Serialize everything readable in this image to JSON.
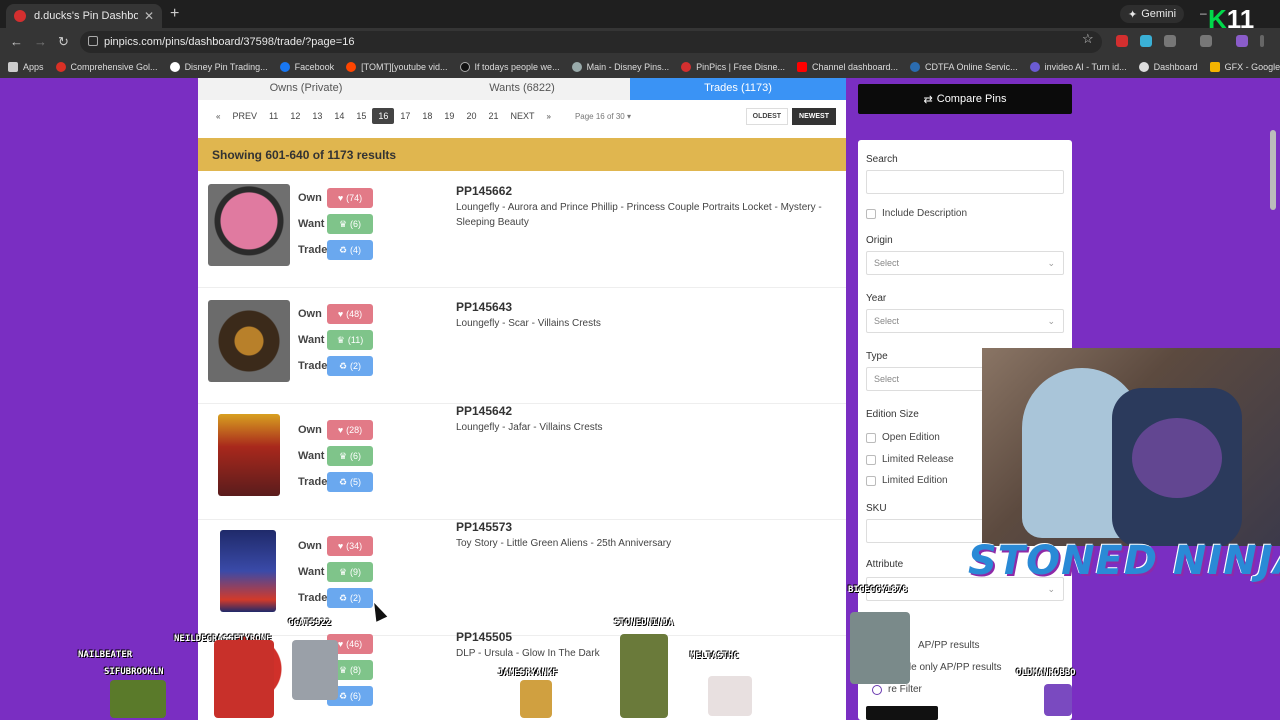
{
  "browser": {
    "tab_title": "d.ducks's Pin Dashboard - PinP",
    "url": "pinpics.com/pins/dashboard/37598/trade/?page=16",
    "gemini_label": "Gemini",
    "bookmarks": [
      {
        "label": "Apps"
      },
      {
        "label": "Comprehensive Gol..."
      },
      {
        "label": "Disney Pin Trading..."
      },
      {
        "label": "Facebook"
      },
      {
        "label": "[TOMT][youtube vid..."
      },
      {
        "label": "If todays people we..."
      },
      {
        "label": "Main - Disney Pins..."
      },
      {
        "label": "PinPics | Free Disne..."
      },
      {
        "label": "Channel dashboard..."
      },
      {
        "label": "CDTFA Online Servic..."
      },
      {
        "label": "invideo AI - Turn id..."
      },
      {
        "label": "Dashboard"
      },
      {
        "label": "GFX - Google Drive"
      }
    ]
  },
  "tabs": [
    {
      "label": "Owns (Private)"
    },
    {
      "label": "Wants (6822)"
    },
    {
      "label": "Trades (1173)"
    }
  ],
  "pager": {
    "prev": "PREV",
    "next": "NEXT",
    "pages": [
      "11",
      "12",
      "13",
      "14",
      "15",
      "16",
      "17",
      "18",
      "19",
      "20",
      "21"
    ],
    "current": "16",
    "page_info": "Page 16 of 30",
    "oldest": "OLDEST",
    "newest": "NEWEST"
  },
  "results_banner": "Showing 601-640 of 1173 results",
  "labels": {
    "own": "Own",
    "want": "Want",
    "trade": "Trade"
  },
  "pins": [
    {
      "id": "PP145662",
      "desc": "Loungefly - Aurora and Prince Phillip - Princess Couple Portraits Locket - Mystery - Sleeping Beauty",
      "own": "(74)",
      "want": "(6)",
      "trade": "(4)",
      "img_color": "#3b3b3b"
    },
    {
      "id": "PP145643",
      "desc": "Loungefly - Scar - Villains Crests",
      "own": "(48)",
      "want": "(11)",
      "trade": "(2)",
      "img_color": "#4a3b2a"
    },
    {
      "id": "PP145642",
      "desc": "Loungefly - Jafar - Villains Crests",
      "own": "(28)",
      "want": "(6)",
      "trade": "(5)",
      "img_color": "#7a2a2a"
    },
    {
      "id": "PP145573",
      "desc": "Toy Story - Little Green Aliens - 25th Anniversary",
      "own": "(34)",
      "want": "(9)",
      "trade": "(2)",
      "img_color": "#3a3f8f"
    },
    {
      "id": "PP145505",
      "desc": "DLP - Ursula - Glow In The Dark",
      "own": "(46)",
      "want": "(8)",
      "trade": "(6)",
      "img_color": "#c23a2a"
    }
  ],
  "sidebar": {
    "compare": "Compare Pins",
    "search": "Search",
    "include_description": "Include Description",
    "origin": "Origin",
    "year": "Year",
    "type": "Type",
    "select": "Select",
    "edition_size": "Edition Size",
    "open_edition": "Open Edition",
    "limited_release": "Limited Release",
    "limited_edition": "Limited Edition",
    "sku": "SKU",
    "attribute": "Attribute",
    "ap_results": "AP/PP results",
    "ap_only": "ude only AP/PP results",
    "more_filter": "re Filter"
  },
  "overlay": {
    "banner": "STONED NINJA",
    "k11": "11",
    "chat_names": [
      "NAILBEATER",
      "SIFUBROOKLN",
      "NEILDEGRASSETYRONE",
      "GCAT5922",
      "STONEDNINJA",
      "JAMESRYANKF",
      "MELTASTHC",
      "BIGEGGY1878",
      "OLDMANROBBO"
    ]
  }
}
